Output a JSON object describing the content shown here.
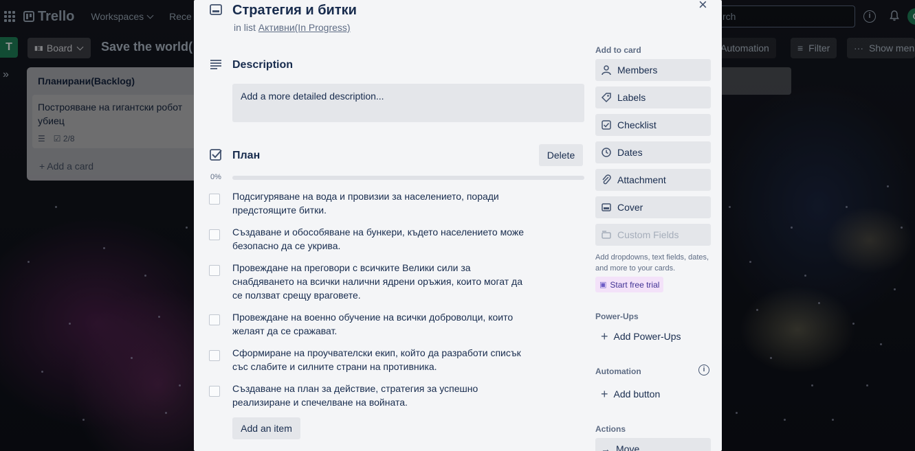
{
  "topbar": {
    "logo": "Trello",
    "nav": [
      "Workspaces",
      "Rece"
    ],
    "search_placeholder": "rch",
    "info_glyph": "i",
    "avatar_initial": "C"
  },
  "board": {
    "workspace_initial": "T",
    "view_label": "Board",
    "title": "Save the world(",
    "automation_label": "Automation",
    "filter_label": "Filter",
    "show_menu_label": "Show menu"
  },
  "background_list": {
    "title": "Планирани(Backlog)",
    "card_title": "Построяване на гигантски робот убиец",
    "card_checklist_badge": "2/8",
    "add_card": "+ Add a card"
  },
  "card": {
    "title": "Стратегия и битки",
    "in_list_prefix": "in list",
    "list_name": "Активни(In Progress)",
    "description_title": "Description",
    "description_placeholder": "Add a more detailed description...",
    "checklist_title": "План",
    "delete_label": "Delete",
    "progress_label": "0%",
    "progress_value": 0,
    "items": [
      "Подсигуряване на вода и провизии за населението, поради предстоящите битки.",
      "Създаване и обособяване на бункери, където населението може безопасно да се укрива.",
      "Провеждане на преговори с всичките Велики сили за снабдяването на всички налични ядрени оръжия, които могат да се ползват срещу враговете.",
      "Провеждане на военно обучение на всички доброволци, които желаят да се сражават.",
      "Сформиране на проучвателски екип, който да разработи списък със слабите и силните страни на противника.",
      "Създаване на план за действие, стратегия за успешно реализиране и спечелване на войната."
    ],
    "add_item_label": "Add an item"
  },
  "sidebar": {
    "add_to_card_label": "Add to card",
    "buttons": [
      "Members",
      "Labels",
      "Checklist",
      "Dates",
      "Attachment",
      "Cover",
      "Custom Fields"
    ],
    "custom_fields_note": "Add dropdowns, text fields, dates, and more to your cards.",
    "trial_label": "Start free trial",
    "powerups_label": "Power-Ups",
    "add_powerups": "Add Power-Ups",
    "automation_label": "Automation",
    "add_button": "Add button",
    "actions_label": "Actions",
    "move_label": "Move"
  },
  "colors": {
    "workspace_green": "#1f845a",
    "modal_bg": "#f4f5f7",
    "button_bg": "#e4e6ea",
    "progress_fill": "#5aac44",
    "trial_bg": "#f3e2f9"
  }
}
